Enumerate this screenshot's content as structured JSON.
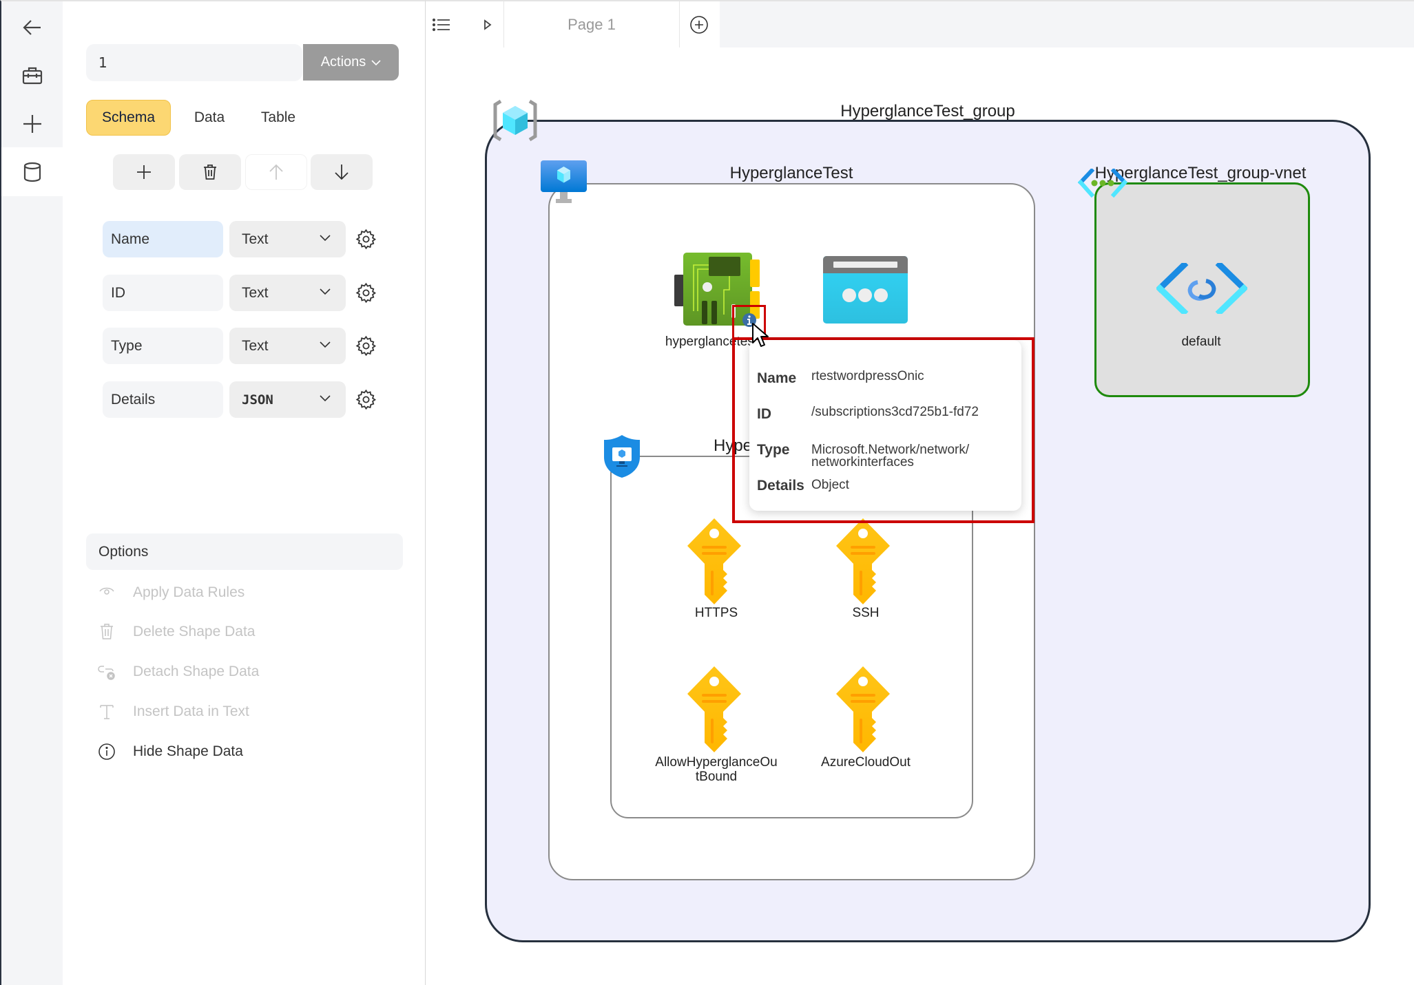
{
  "rail": {
    "items": [
      {
        "name": "back",
        "icon": "arrow-left-icon"
      },
      {
        "name": "toolbox",
        "icon": "briefcase-icon"
      },
      {
        "name": "add",
        "icon": "plus-icon"
      },
      {
        "name": "data",
        "icon": "database-icon",
        "active": true
      }
    ]
  },
  "panel": {
    "shape_input_value": "1",
    "actions_label": "Actions",
    "tabs": [
      {
        "label": "Schema",
        "active": true
      },
      {
        "label": "Data",
        "active": false
      },
      {
        "label": "Table",
        "active": false
      }
    ],
    "toolbar": [
      {
        "name": "add-field",
        "icon": "plus-icon",
        "enabled": true
      },
      {
        "name": "delete-field",
        "icon": "trash-icon",
        "enabled": true
      },
      {
        "name": "move-up",
        "icon": "arrow-up-icon",
        "enabled": false
      },
      {
        "name": "move-down",
        "icon": "arrow-down-icon",
        "enabled": true
      }
    ],
    "schema": [
      {
        "field": "Name",
        "type": "Text",
        "selected": true
      },
      {
        "field": "ID",
        "type": "Text",
        "selected": false
      },
      {
        "field": "Type",
        "type": "Text",
        "selected": false
      },
      {
        "field": "Details",
        "type": "JSON",
        "selected": false
      }
    ],
    "options": {
      "title": "Options",
      "items": [
        {
          "label": "Apply Data Rules",
          "icon": "eye-icon",
          "enabled": false
        },
        {
          "label": "Delete Shape Data",
          "icon": "trash-icon",
          "enabled": false
        },
        {
          "label": "Detach Shape Data",
          "icon": "unlink-icon",
          "enabled": false
        },
        {
          "label": "Insert Data in Text",
          "icon": "text-icon",
          "enabled": false
        },
        {
          "label": "Hide Shape Data",
          "icon": "info-icon",
          "enabled": true
        }
      ]
    }
  },
  "canvas": {
    "page_tab": "Page 1",
    "diagram": {
      "resource_group": "HyperglanceTest_group",
      "vm": "HyperglanceTest",
      "vnet": "HyperglanceTest_group-vnet",
      "subnet": "default",
      "nic_label": "hyperglancetest",
      "nsg_label_visible": "Hype",
      "rules": [
        "HTTPS",
        "SSH",
        "AllowHyperglanceOutBound",
        "AzureCloudOut"
      ],
      "rule_labels_wrapped": [
        "HTTPS",
        "SSH",
        "AllowHyperglanceOu\ntBound",
        "AzureCloudOut"
      ]
    },
    "popup": {
      "rows": [
        {
          "key": "Name",
          "value": "rtestwordpressOnic"
        },
        {
          "key": "ID",
          "value": "/subscriptions3cd725b1-fd72"
        },
        {
          "key": "Type",
          "value": "Microsoft.Network/network/\nnetworkinterfaces"
        },
        {
          "key": "Details",
          "value": "Object"
        }
      ]
    },
    "colors": {
      "highlight": "#cc0000",
      "group_fill": "#efeffc",
      "vnet_border": "#1e8a0c",
      "schema_tab_active": "#fcd772"
    }
  }
}
